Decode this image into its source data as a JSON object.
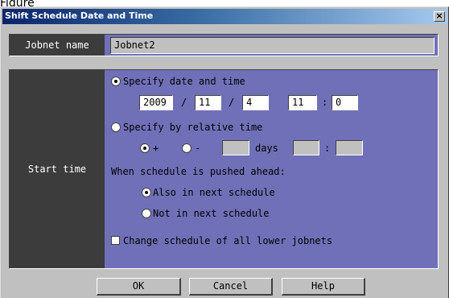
{
  "fig_label": "Figure",
  "window": {
    "title": "Shift Schedule Date and Time",
    "close_glyph": "×"
  },
  "jobnet": {
    "label": "Jobnet name",
    "value": "Jobnet2"
  },
  "start_time": {
    "label": "Start time",
    "specify_date_label": "Specify date and time",
    "year": "2009",
    "month": "11",
    "day": "4",
    "hour": "11",
    "minute": "0",
    "date_sep_1": "/",
    "date_sep_2": "/",
    "time_sep": ":",
    "relative_label": "Specify by relative time",
    "plus_label": "+",
    "minus_label": "-",
    "days_label": "days",
    "rel_time_sep": ":",
    "pushed_label": "When schedule is pushed ahead:",
    "also_next_label": "Also in next schedule",
    "not_next_label": "Not in next schedule",
    "change_lower_label": "Change schedule of all lower jobnets",
    "selected_mode": "date_and_time",
    "selected_sign": "+",
    "selected_pushed": "also",
    "change_lower_checked": false
  },
  "buttons": {
    "ok": "OK",
    "cancel": "Cancel",
    "help": "Help"
  }
}
